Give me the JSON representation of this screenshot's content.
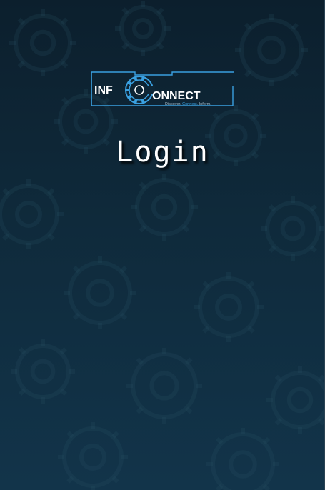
{
  "logo": {
    "part1": "INF",
    "part2": "ONNECT",
    "tagline_1": "Discover.",
    "tagline_2": "Connect.",
    "tagline_3": "Inform.",
    "icon": "gear-icon"
  },
  "page": {
    "title": "Login"
  },
  "colors": {
    "background_top": "#0c1f2d",
    "background_bottom": "#12344a",
    "accent_blue": "#3aa0e0",
    "text": "#ffffff"
  }
}
